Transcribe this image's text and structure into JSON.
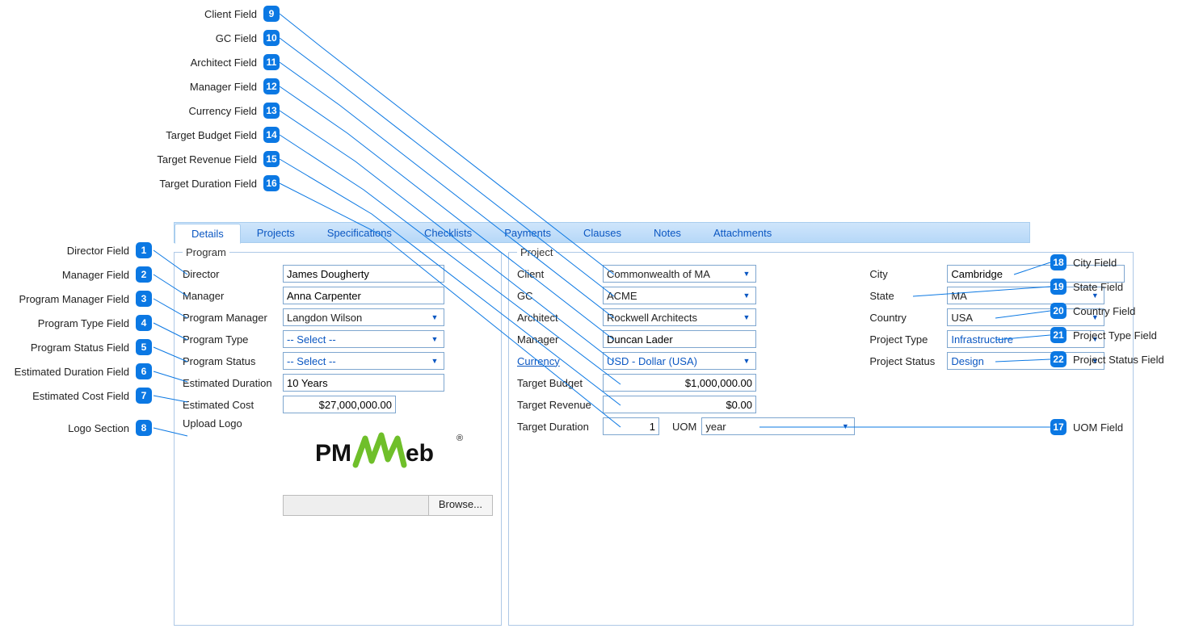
{
  "tabs": [
    "Details",
    "Projects",
    "Specifications",
    "Checklists",
    "Payments",
    "Clauses",
    "Notes",
    "Attachments"
  ],
  "active_tab": "Details",
  "program": {
    "legend": "Program",
    "director_label": "Director",
    "director": "James Dougherty",
    "manager_label": "Manager",
    "manager": "Anna Carpenter",
    "pm_label": "Program Manager",
    "pm": "Langdon Wilson",
    "type_label": "Program Type",
    "type": "-- Select --",
    "status_label": "Program Status",
    "status": "-- Select --",
    "est_duration_label": "Estimated Duration",
    "est_duration": "10 Years",
    "est_cost_label": "Estimated Cost",
    "est_cost": "$27,000,000.00",
    "upload_label": "Upload Logo",
    "browse_label": "Browse..."
  },
  "project": {
    "legend": "Project",
    "client_label": "Client",
    "client": "Commonwealth of MA",
    "gc_label": "GC",
    "gc": "ACME",
    "architect_label": "Architect",
    "architect": "Rockwell Architects",
    "manager_label": "Manager",
    "manager": "Duncan Lader",
    "currency_label": "Currency",
    "currency": "USD - Dollar (USA)",
    "target_budget_label": "Target Budget",
    "target_budget": "$1,000,000.00",
    "target_revenue_label": "Target Revenue",
    "target_revenue": "$0.00",
    "target_duration_label": "Target Duration",
    "target_duration": "1",
    "uom_label": "UOM",
    "uom": "year",
    "city_label": "City",
    "city": "Cambridge",
    "state_label": "State",
    "state": "MA",
    "country_label": "Country",
    "country": "USA",
    "ptype_label": "Project Type",
    "ptype": "Infrastructure",
    "pstatus_label": "Project Status",
    "pstatus": "Design"
  },
  "callouts_left_upper": [
    {
      "n": "9",
      "t": "Client Field"
    },
    {
      "n": "10",
      "t": "GC Field"
    },
    {
      "n": "11",
      "t": "Architect Field"
    },
    {
      "n": "12",
      "t": "Manager Field"
    },
    {
      "n": "13",
      "t": "Currency Field"
    },
    {
      "n": "14",
      "t": "Target Budget Field"
    },
    {
      "n": "15",
      "t": "Target Revenue Field"
    },
    {
      "n": "16",
      "t": "Target Duration Field"
    }
  ],
  "callouts_left_lower": [
    {
      "n": "1",
      "t": "Director Field"
    },
    {
      "n": "2",
      "t": "Manager Field"
    },
    {
      "n": "3",
      "t": "Program Manager Field"
    },
    {
      "n": "4",
      "t": "Program Type Field"
    },
    {
      "n": "5",
      "t": "Program Status Field"
    },
    {
      "n": "6",
      "t": "Estimated Duration Field"
    },
    {
      "n": "7",
      "t": "Estimated Cost Field"
    },
    {
      "n": "8",
      "t": "Logo Section"
    }
  ],
  "callouts_right": [
    {
      "n": "18",
      "t": "City Field"
    },
    {
      "n": "19",
      "t": "State Field"
    },
    {
      "n": "20",
      "t": "Country Field"
    },
    {
      "n": "21",
      "t": "Project Type Field"
    },
    {
      "n": "22",
      "t": "Project Status Field"
    },
    {
      "n": "17",
      "t": "UOM Field"
    }
  ]
}
